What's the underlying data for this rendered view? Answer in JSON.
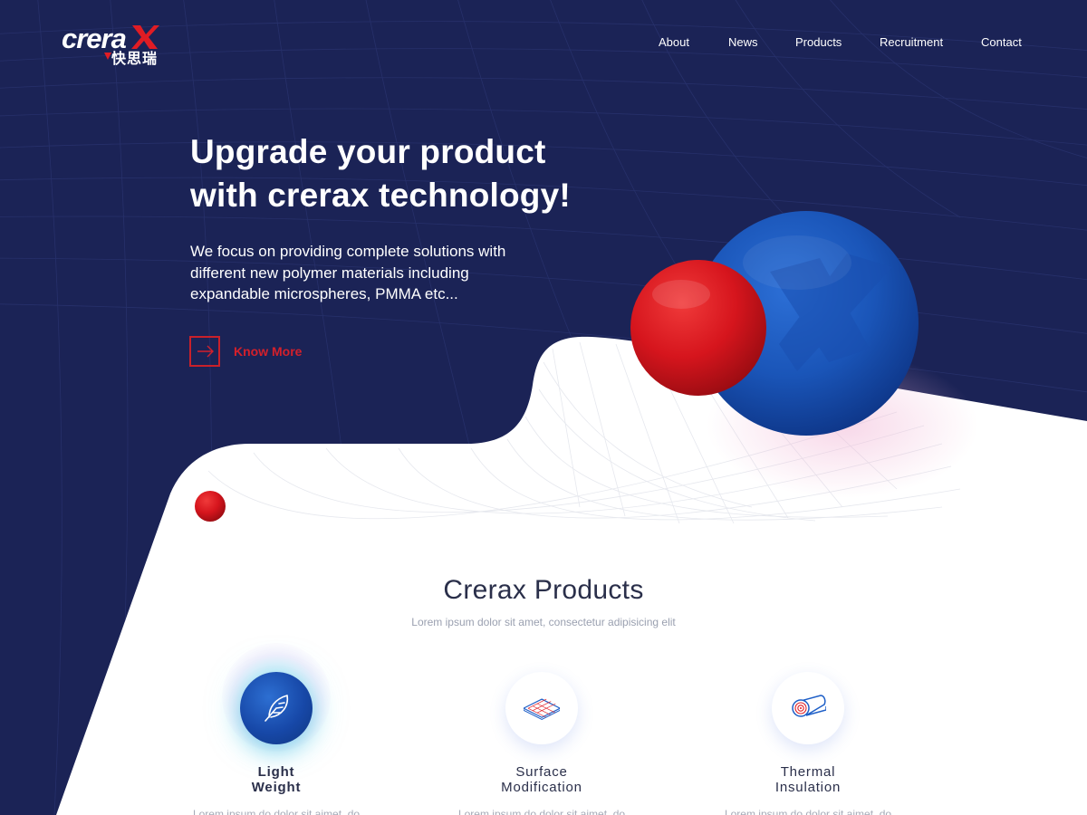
{
  "brand": {
    "logo_text": "crera",
    "logo_mark": "X",
    "logo_chinese": "快思瑞",
    "navy": "#1b2356",
    "red": "#e01c24",
    "blue": "#1d5ec7"
  },
  "nav": {
    "items": [
      {
        "label": "About"
      },
      {
        "label": "News"
      },
      {
        "label": "Products"
      },
      {
        "label": "Recruitment"
      },
      {
        "label": "Contact"
      }
    ]
  },
  "hero": {
    "title_line1": "Upgrade your product",
    "title_line2": "with crerax technology!",
    "desc_line1": "We focus on providing complete solutions with",
    "desc_line2": "different new polymer materials including",
    "desc_line3": "expandable microspheres, PMMA etc...",
    "cta_label": "Know More",
    "cta_icon": "arrow-right-icon"
  },
  "products_section": {
    "title": "Crerax Products",
    "subtitle": "Lorem ipsum dolor sit amet, consectetur adipisicing elit",
    "items": [
      {
        "line1": "Light",
        "line2": "Weight",
        "icon": "feather-icon",
        "active": true,
        "desc": "Lorem ipsum do dolor sit aimet, do"
      },
      {
        "line1": "Surface",
        "line2": "Modification",
        "icon": "surface-grid-icon",
        "active": false,
        "desc": "Lorem ipsum do dolor sit aimet, do"
      },
      {
        "line1": "Thermal",
        "line2": "Insulation",
        "icon": "insulation-roll-icon",
        "active": false,
        "desc": "Lorem ipsum do dolor sit aimet, do"
      }
    ]
  }
}
